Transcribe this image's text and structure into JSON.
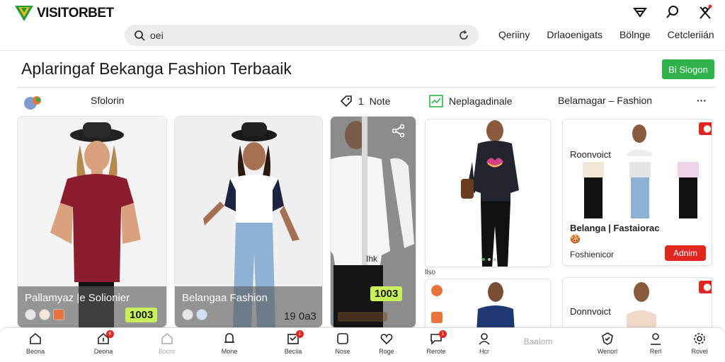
{
  "header": {
    "logo_text": "VISITORBET",
    "search_value": "oei",
    "nav_links": [
      "Qeriiny",
      "Drlaoenigats",
      "Bölnge",
      "Cetcleriián"
    ]
  },
  "title_row": {
    "title": "Aplaringaf Bekanga Fashion Terbaaik",
    "action_button": "Bi Slogon"
  },
  "filter_row": {
    "item1": "Sfolorin",
    "item2_count": "1",
    "item2_label": "Note",
    "item3": "Neplagadinale",
    "item4": "Belamagar – Fashion",
    "more": "···"
  },
  "cards": [
    {
      "caption": "Pallamyaz |e Solionier",
      "price": "1003"
    },
    {
      "caption": "Belangaa Fashion",
      "price": "19 0a3"
    },
    {
      "caption": "",
      "price": "1003"
    }
  ],
  "side_label": "Ihk",
  "mini_label": "llso",
  "right_cards": {
    "top": {
      "header": "Roonvoict",
      "title": "Belanga | Fastaiorac",
      "subtitle": "Foshienicor",
      "button": "Adnim"
    },
    "bottom": {
      "header": "Donnvoict"
    }
  },
  "bottom_nav": [
    {
      "label": "Beona",
      "icon": "home-icon"
    },
    {
      "label": "Deona",
      "icon": "bag-icon",
      "badge": "6"
    },
    {
      "label": "Boonr",
      "icon": "home-outline-icon",
      "faded": true
    },
    {
      "label": "Mone",
      "icon": "bell-icon"
    },
    {
      "label": "Beciia",
      "icon": "inbox-icon",
      "badge": "1"
    },
    {
      "label": "Nose",
      "icon": "square-icon"
    },
    {
      "label": "Roge",
      "icon": "heart-icon"
    },
    {
      "label": "Rerote",
      "icon": "chat-icon",
      "badge": "1"
    },
    {
      "label": "Hcr",
      "icon": "user-icon"
    },
    {
      "label": "Baalom",
      "icon": "none",
      "faded": true
    },
    {
      "label": "Wenorl",
      "icon": "shield-icon"
    },
    {
      "label": "Rerl",
      "icon": "user-outline-icon"
    },
    {
      "label": "Rovel",
      "icon": "settings-icon"
    }
  ],
  "colors": {
    "accent_green": "#2db34a",
    "badge_red": "#e0261f",
    "price_lime": "#c8f05a"
  }
}
